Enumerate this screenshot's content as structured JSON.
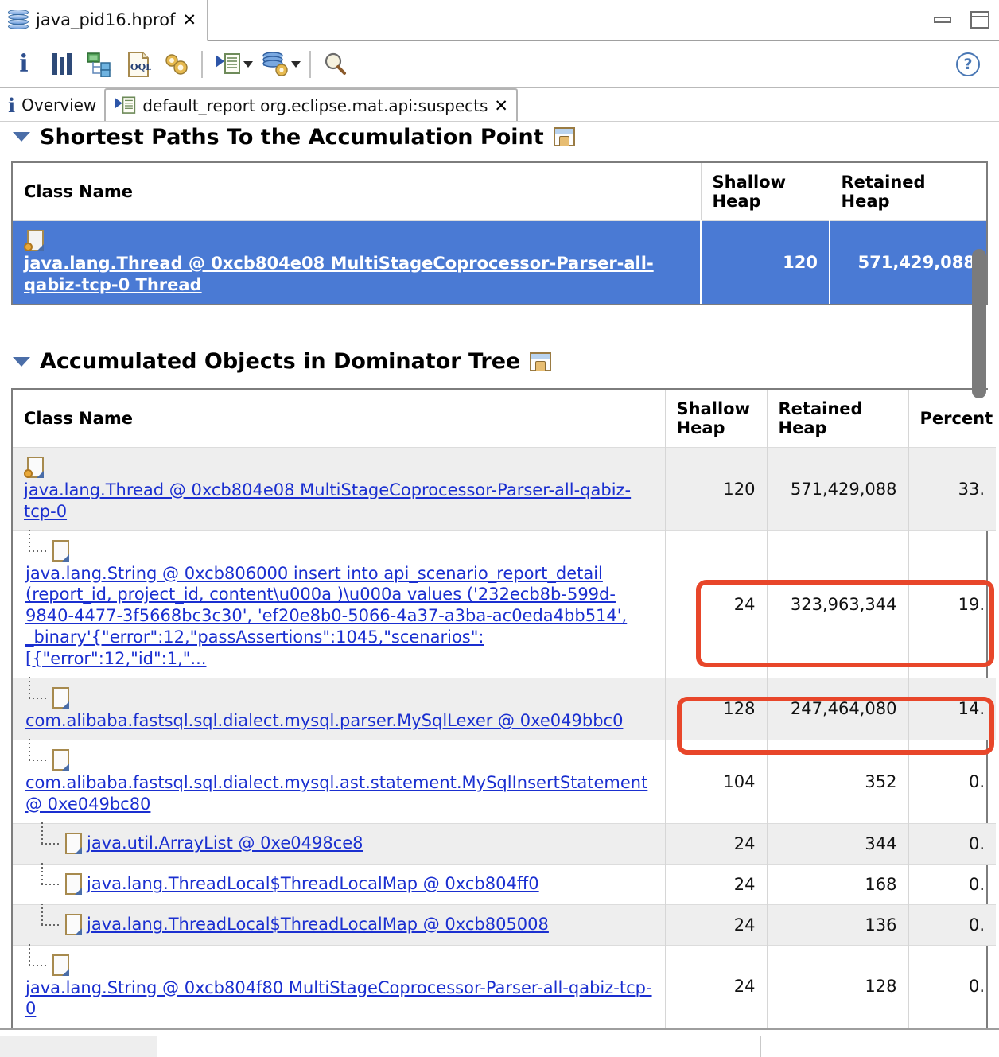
{
  "window": {
    "file_tab_label": "java_pid16.hprof",
    "file_tab_close": "✕",
    "minimize_label": "Minimize",
    "maximize_label": "Maximize",
    "heap_icon": "heap-dump-icon"
  },
  "toolbar": {
    "items": [
      {
        "name": "info-icon",
        "glyph": "i"
      },
      {
        "name": "histogram-icon",
        "glyph": "bars"
      },
      {
        "name": "dominator-tree-icon",
        "glyph": "tree"
      },
      {
        "name": "oql-icon",
        "glyph": "OQL"
      },
      {
        "name": "settings-icon",
        "glyph": "gears"
      },
      {
        "name": "run-expert-report-icon",
        "glyph": "report"
      },
      {
        "name": "heap-dump-overview-icon",
        "glyph": "heap-gear"
      },
      {
        "name": "search-icon",
        "glyph": "magnifier"
      }
    ],
    "help_label": "?"
  },
  "view_tabs": [
    {
      "label": "Overview",
      "icon": "info-icon",
      "active": false
    },
    {
      "label": "default_report  org.eclipse.mat.api:suspects",
      "icon": "report-icon",
      "active": true,
      "close": "✕"
    }
  ],
  "sections": [
    {
      "title": "Shortest Paths To the Accumulation Point",
      "expanded": true,
      "open_icon": "open-in-new-window-icon"
    },
    {
      "title": "Accumulated Objects in Dominator Tree",
      "expanded": true,
      "open_icon": "open-in-new-window-icon"
    }
  ],
  "shortest_paths_table": {
    "columns": [
      "Class Name",
      "Shallow Heap",
      "Retained Heap"
    ],
    "rows": [
      {
        "class_name": "java.lang.Thread @ 0xcb804e08 MultiStageCoprocessor-Parser-all-qabiz-tcp-0 Thread",
        "shallow_heap": "120",
        "retained_heap": "571,429,088",
        "selected": true
      }
    ]
  },
  "dominator_tree_table": {
    "columns": [
      "Class Name",
      "Shallow Heap",
      "Retained Heap",
      "Percent"
    ],
    "rows": [
      {
        "class_name": "java.lang.Thread @ 0xcb804e08 MultiStageCoprocessor-Parser-all-qabiz-tcp-0",
        "shallow_heap": "120",
        "retained_heap": "571,429,088",
        "percent": "33.",
        "depth": 0,
        "alt": true
      },
      {
        "class_name": "java.lang.String @ 0xcb806000 insert into api_scenario_report_detail (report_id, project_id, content\\u000a )\\u000a values ('232ecb8b-599d-9840-4477-3f5668bc3c30', 'ef20e8b0-5066-4a37-a3ba-ac0eda4bb514', _binary'{\"error\":12,\"passAssertions\":1045,\"scenarios\":[{\"error\":12,\"id\":1,\"...",
        "shallow_heap": "24",
        "retained_heap": "323,963,344",
        "percent": "19.",
        "depth": 1,
        "alt": false,
        "highlighted": true
      },
      {
        "class_name": "com.alibaba.fastsql.sql.dialect.mysql.parser.MySqlLexer @ 0xe049bbc0",
        "shallow_heap": "128",
        "retained_heap": "247,464,080",
        "percent": "14.",
        "depth": 1,
        "alt": true,
        "highlighted": true
      },
      {
        "class_name": "com.alibaba.fastsql.sql.dialect.mysql.ast.statement.MySqlInsertStatement @ 0xe049bc80",
        "shallow_heap": "104",
        "retained_heap": "352",
        "percent": "0.",
        "depth": 1,
        "alt": false
      },
      {
        "class_name": "java.util.ArrayList @ 0xe0498ce8",
        "shallow_heap": "24",
        "retained_heap": "344",
        "percent": "0.",
        "depth": 2,
        "alt": true,
        "compact": true
      },
      {
        "class_name": "java.lang.ThreadLocal$ThreadLocalMap @ 0xcb804ff0",
        "shallow_heap": "24",
        "retained_heap": "168",
        "percent": "0.",
        "depth": 2,
        "alt": false,
        "compact": true
      },
      {
        "class_name": "java.lang.ThreadLocal$ThreadLocalMap @ 0xcb805008",
        "shallow_heap": "24",
        "retained_heap": "136",
        "percent": "0.",
        "depth": 2,
        "alt": true,
        "compact": true
      },
      {
        "class_name": "java.lang.String @ 0xcb804f80 MultiStageCoprocessor-Parser-all-qabiz-tcp-0",
        "shallow_heap": "24",
        "retained_heap": "128",
        "percent": "0.",
        "depth": 1,
        "alt": false
      }
    ]
  },
  "colors": {
    "selection_blue": "#4a7ad4",
    "link_blue": "#1a2fd0",
    "annotation_red": "#e8462a",
    "alt_row_gray": "#eeeeee"
  }
}
